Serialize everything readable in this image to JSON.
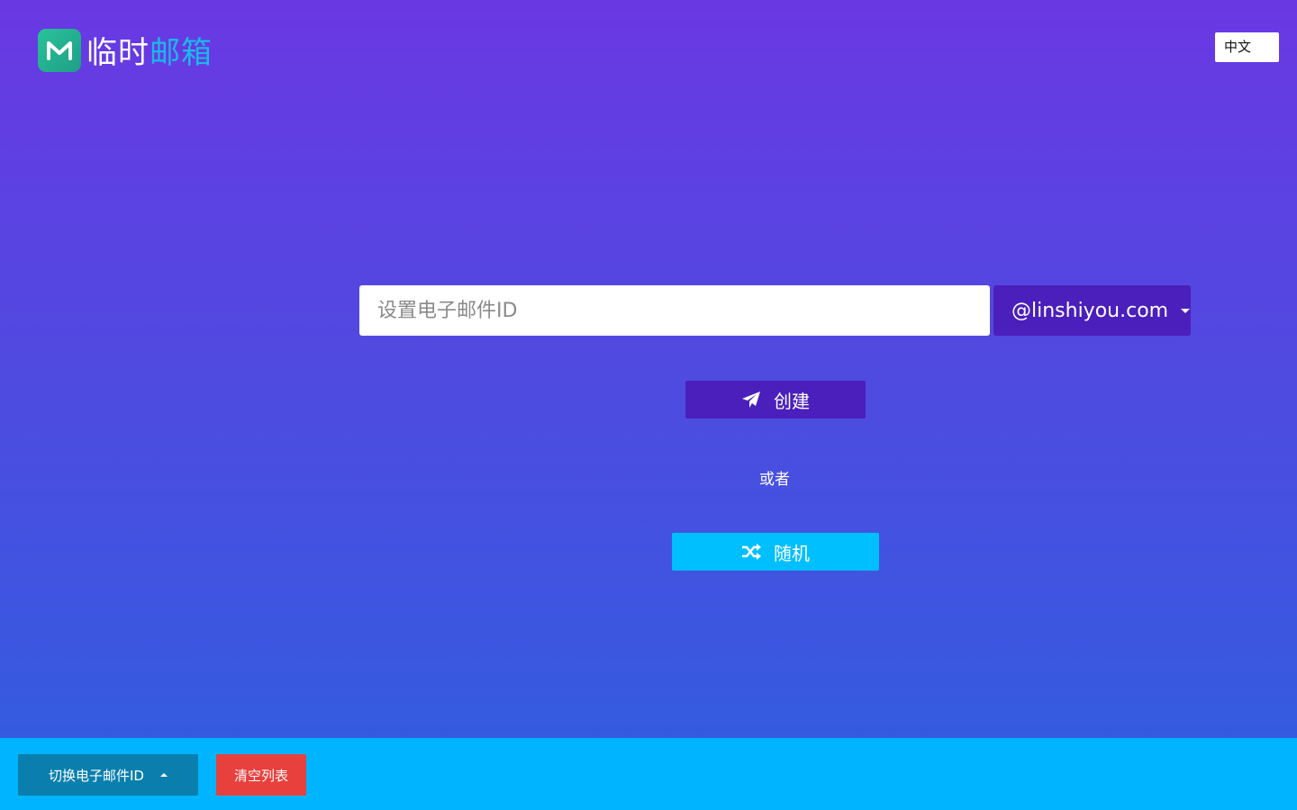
{
  "header": {
    "logo_text_white": "临时",
    "logo_text_cyan": "邮箱",
    "language_label": "中文"
  },
  "form": {
    "email_placeholder": "设置电子邮件ID",
    "email_value": "",
    "domain_selected": "@linshiyou.com",
    "create_label": "创建",
    "or_label": "或者",
    "random_label": "随机"
  },
  "bottom_bar": {
    "switch_label": "切换电子邮件ID",
    "clear_label": "清空列表"
  },
  "icons": {
    "logo": "m-logo-icon",
    "create": "paper-plane-icon",
    "random": "shuffle-icon",
    "domain_dropdown": "caret-down-icon",
    "switch_dropup": "caret-up-icon"
  },
  "colors": {
    "bg_top": "#6a38e3",
    "bg_bottom": "#2f5ee0",
    "primary_button": "#4a1fbb",
    "random_button": "#00bfff",
    "bottom_bar": "#00b4ff",
    "switch_button": "#0a7fad",
    "clear_button": "#e8403d",
    "logo_green": "#28c39a",
    "logo_cyan": "#1ab9e8"
  }
}
